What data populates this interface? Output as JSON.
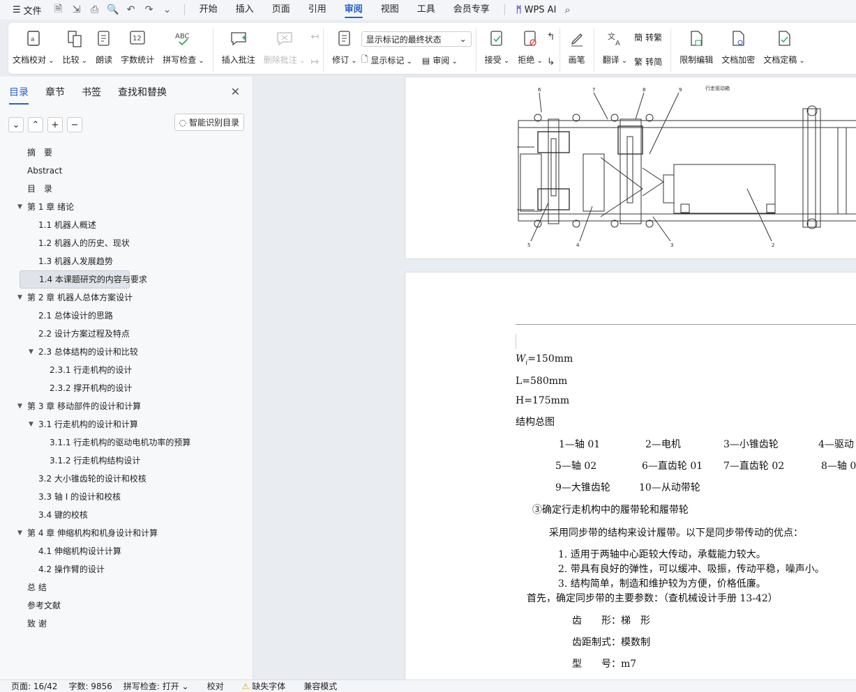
{
  "menubar": {
    "file": "文件",
    "tabs": [
      "开始",
      "插入",
      "页面",
      "引用",
      "审阅",
      "视图",
      "工具",
      "会员专享"
    ],
    "active_tab": "审阅",
    "wps_ai": "WPS AI"
  },
  "ribbon": {
    "proof": "文档校对",
    "compare": "比较",
    "read": "朗读",
    "wordcount": "字数统计",
    "spell": "拼写检查",
    "insert_comment": "插入批注",
    "delete_comment": "删除批注",
    "revise": "修订",
    "display_select": "显示标记的最终状态",
    "show_marks": "显示标记",
    "review": "审阅",
    "accept": "接受",
    "reject": "拒绝",
    "pen": "画笔",
    "translate": "翻译",
    "to_trad": "转繁",
    "to_simp": "转简",
    "restrict": "限制编辑",
    "encrypt": "文档加密",
    "finalize": "文档定稿"
  },
  "panel": {
    "tabs": [
      "目录",
      "章节",
      "书签",
      "查找和替换"
    ],
    "smart": "智能识别目录",
    "toc": [
      {
        "t": "摘　要",
        "l": 0
      },
      {
        "t": "Abstract",
        "l": 0
      },
      {
        "t": "目　录",
        "l": 0
      },
      {
        "t": "第 1 章  绪论",
        "l": 0,
        "c": true
      },
      {
        "t": "1.1  机器人概述",
        "l": 1
      },
      {
        "t": "1.2  机器人的历史、现状",
        "l": 1
      },
      {
        "t": "1.3 机器人发展趋势",
        "l": 1
      },
      {
        "t": "1.4  本课题研究的内容与要求",
        "l": 1,
        "s": true
      },
      {
        "t": "第 2 章  机器人总体方案设计",
        "l": 0,
        "c": true
      },
      {
        "t": "2.1 总体设计的思路",
        "l": 1
      },
      {
        "t": "2.2  设计方案过程及特点",
        "l": 1
      },
      {
        "t": "2.3  总体结构的设计和比较",
        "l": 1,
        "c": true
      },
      {
        "t": "2.3.1  行走机构的设计",
        "l": 2
      },
      {
        "t": "2.3.2  撑开机构的设计",
        "l": 2
      },
      {
        "t": "第 3 章  移动部件的设计和计算",
        "l": 0,
        "c": true
      },
      {
        "t": "3.1  行走机构的设计和计算",
        "l": 1,
        "c": true
      },
      {
        "t": "3.1.1  行走机构的驱动电机功率的预算",
        "l": 2
      },
      {
        "t": "3.1.2  行走机构结构设计",
        "l": 2
      },
      {
        "t": "3.2 大小锥齿轮的设计和校核",
        "l": 1
      },
      {
        "t": "3.3  轴 I 的设计和校核",
        "l": 1
      },
      {
        "t": "3.4  键的校核",
        "l": 1
      },
      {
        "t": "第 4 章  伸缩机构和机身设计和计算",
        "l": 0,
        "c": true
      },
      {
        "t": "4.1  伸缩机构设计计算",
        "l": 1
      },
      {
        "t": "4.2  操作臂的设计",
        "l": 1
      },
      {
        "t": "总 结",
        "l": 0
      },
      {
        "t": "参考文献",
        "l": 0
      },
      {
        "t": "致 谢",
        "l": 0
      }
    ]
  },
  "doc": {
    "drawing_title": "行走驱动箱",
    "callouts": [
      "6",
      "7",
      "8",
      "9",
      "5",
      "4",
      "3",
      "2"
    ],
    "w_sub": "i",
    "w_val": "=150mm",
    "w_sym": "W",
    "l": "L=580mm",
    "h": "H=175mm",
    "struct": "结构总图",
    "legend1": [
      "1—轴 01",
      "2—电机",
      "3—小锥齿轮",
      "4—驱动"
    ],
    "legend2": [
      "5—轴 02",
      "6—直齿轮 01",
      "7—直齿轮 02",
      "8—轴 0"
    ],
    "legend3": [
      "9—大锥齿轮",
      "10—从动带轮"
    ],
    "h3": "③确定行走机构中的履带轮和履带轮",
    "p1": "采用同步带的结构来设计履带。以下是同步带传动的优点：",
    "li1": "1.  适用于两轴中心距较大传动，承载能力较大。",
    "li2": "2.  带具有良好的弹性，可以缓冲、吸振，传动平稳，噪声小。",
    "li3": "3.  结构简单，制造和维护较为方便，价格低廉。",
    "p2": "首先，确定同步带的主要参数：（查机械设计手册 13-42）",
    "a1": "齿　　形：梯　形",
    "a2": "齿距制式：模数制",
    "a3": "型　　号：m7"
  },
  "status": {
    "page": "页面: 16/42",
    "words": "字数: 9856",
    "spell": "拼写检查: 打开",
    "proof": "校对",
    "font": "缺失字体",
    "compat": "兼容模式"
  }
}
